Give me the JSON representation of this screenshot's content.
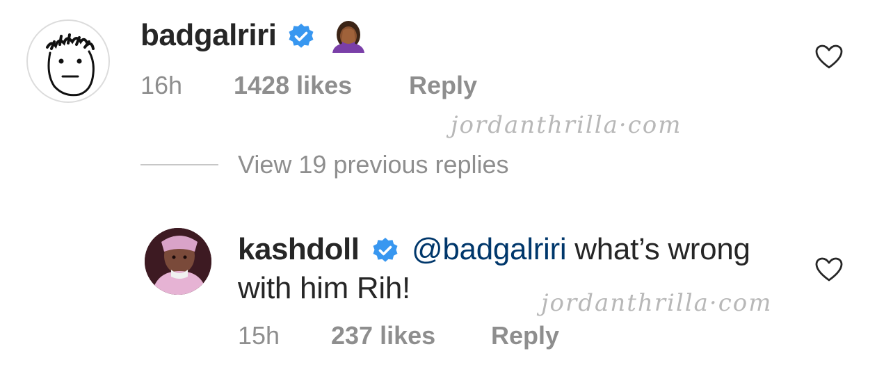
{
  "comment": {
    "username": "badgalriri",
    "verified": true,
    "emoji_icon": "woman-facepalming-emoji",
    "time": "16h",
    "likes": "1428 likes",
    "reply_label": "Reply"
  },
  "view_replies": "View 19 previous replies",
  "reply": {
    "username": "kashdoll",
    "verified": true,
    "mention": "@badgalriri",
    "text_line1": " what’s wrong",
    "text_line2": "with him Rih!",
    "time": "15h",
    "likes": "237 likes",
    "reply_label": "Reply"
  },
  "watermarks": [
    "jordanthrilla·com",
    "jordanthrilla·com"
  ],
  "colors": {
    "verified_badge": "#3897f0",
    "secondary_text": "#8e8e8e",
    "mention": "#00376b"
  }
}
